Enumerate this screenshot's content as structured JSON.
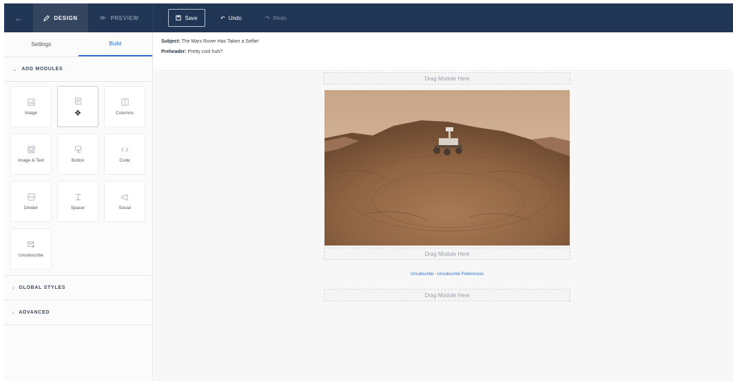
{
  "topbar": {
    "back_icon": "arrow-left-icon",
    "tabs": [
      {
        "label": "DESIGN",
        "icon": "pencil-icon",
        "active": true
      },
      {
        "label": "PREVIEW",
        "icon": "eye-icon",
        "active": false
      }
    ],
    "save_label": "Save",
    "undo_label": "Undo",
    "redo_label": "Redo"
  },
  "sidebar": {
    "tabs": [
      "Settings",
      "Build"
    ],
    "active_tab": "Build",
    "sections": {
      "add_modules": "ADD MODULES",
      "global_styles": "GLOBAL STYLES",
      "advanced": "ADVANCED"
    },
    "modules": [
      {
        "label": "Image",
        "icon": "image-icon"
      },
      {
        "label": "",
        "icon": "text-icon",
        "dragging": true
      },
      {
        "label": "Columns",
        "icon": "columns-icon"
      },
      {
        "label": "Image & Text",
        "icon": "image-text-icon"
      },
      {
        "label": "Button",
        "icon": "button-icon"
      },
      {
        "label": "Code",
        "icon": "code-icon"
      },
      {
        "label": "Divider",
        "icon": "divider-icon"
      },
      {
        "label": "Spacer",
        "icon": "spacer-icon"
      },
      {
        "label": "Social",
        "icon": "megaphone-icon"
      },
      {
        "label": "Unsubscribe",
        "icon": "unsubscribe-icon"
      }
    ]
  },
  "email": {
    "subject_label": "Subject:",
    "subject": "The Mars Rover Has Taken a Selfie!",
    "preheader_label": "Preheader:",
    "preheader": "Pretty cool huh?",
    "drop_zone_label": "Drag Module Here",
    "unsubscribe_text": "Unsubscribe - Unsubscribe Preferences"
  },
  "colors": {
    "topbar_bg": "#213554",
    "accent": "#2c6fd1"
  }
}
